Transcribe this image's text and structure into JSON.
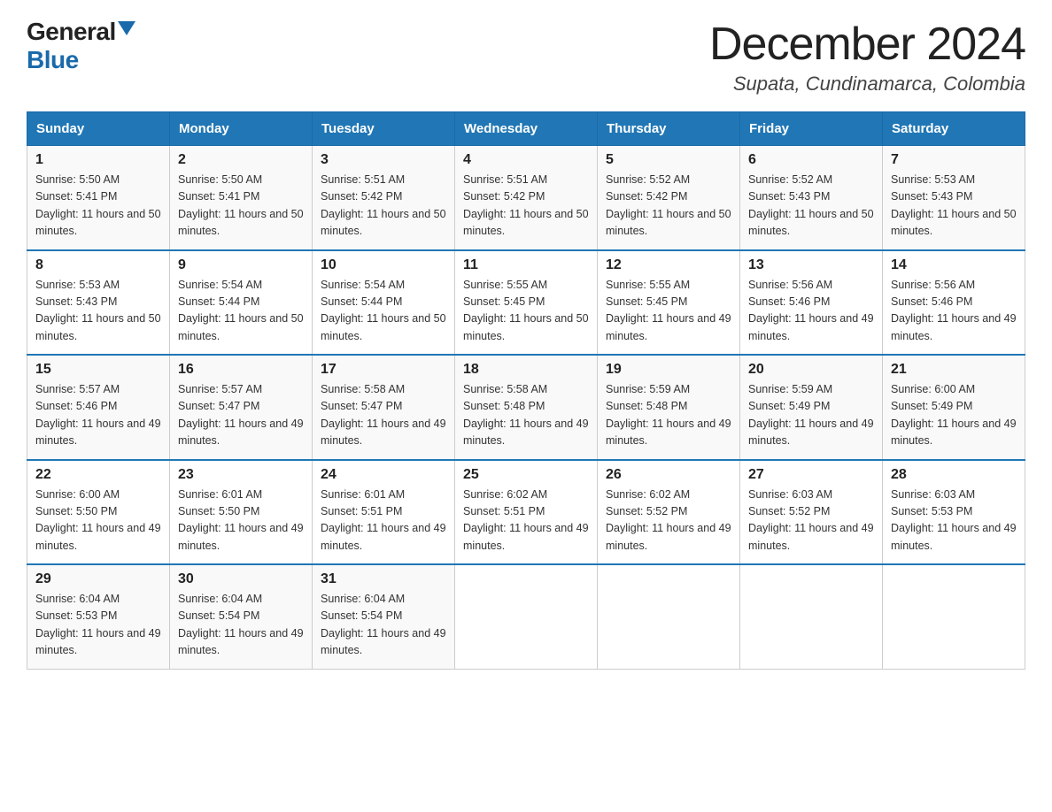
{
  "header": {
    "logo_general": "General",
    "logo_blue": "Blue",
    "month_title": "December 2024",
    "location": "Supata, Cundinamarca, Colombia"
  },
  "weekdays": [
    "Sunday",
    "Monday",
    "Tuesday",
    "Wednesday",
    "Thursday",
    "Friday",
    "Saturday"
  ],
  "weeks": [
    [
      {
        "day": 1,
        "sunrise": "5:50 AM",
        "sunset": "5:41 PM",
        "daylight": "11 hours and 50 minutes."
      },
      {
        "day": 2,
        "sunrise": "5:50 AM",
        "sunset": "5:41 PM",
        "daylight": "11 hours and 50 minutes."
      },
      {
        "day": 3,
        "sunrise": "5:51 AM",
        "sunset": "5:42 PM",
        "daylight": "11 hours and 50 minutes."
      },
      {
        "day": 4,
        "sunrise": "5:51 AM",
        "sunset": "5:42 PM",
        "daylight": "11 hours and 50 minutes."
      },
      {
        "day": 5,
        "sunrise": "5:52 AM",
        "sunset": "5:42 PM",
        "daylight": "11 hours and 50 minutes."
      },
      {
        "day": 6,
        "sunrise": "5:52 AM",
        "sunset": "5:43 PM",
        "daylight": "11 hours and 50 minutes."
      },
      {
        "day": 7,
        "sunrise": "5:53 AM",
        "sunset": "5:43 PM",
        "daylight": "11 hours and 50 minutes."
      }
    ],
    [
      {
        "day": 8,
        "sunrise": "5:53 AM",
        "sunset": "5:43 PM",
        "daylight": "11 hours and 50 minutes."
      },
      {
        "day": 9,
        "sunrise": "5:54 AM",
        "sunset": "5:44 PM",
        "daylight": "11 hours and 50 minutes."
      },
      {
        "day": 10,
        "sunrise": "5:54 AM",
        "sunset": "5:44 PM",
        "daylight": "11 hours and 50 minutes."
      },
      {
        "day": 11,
        "sunrise": "5:55 AM",
        "sunset": "5:45 PM",
        "daylight": "11 hours and 50 minutes."
      },
      {
        "day": 12,
        "sunrise": "5:55 AM",
        "sunset": "5:45 PM",
        "daylight": "11 hours and 49 minutes."
      },
      {
        "day": 13,
        "sunrise": "5:56 AM",
        "sunset": "5:46 PM",
        "daylight": "11 hours and 49 minutes."
      },
      {
        "day": 14,
        "sunrise": "5:56 AM",
        "sunset": "5:46 PM",
        "daylight": "11 hours and 49 minutes."
      }
    ],
    [
      {
        "day": 15,
        "sunrise": "5:57 AM",
        "sunset": "5:46 PM",
        "daylight": "11 hours and 49 minutes."
      },
      {
        "day": 16,
        "sunrise": "5:57 AM",
        "sunset": "5:47 PM",
        "daylight": "11 hours and 49 minutes."
      },
      {
        "day": 17,
        "sunrise": "5:58 AM",
        "sunset": "5:47 PM",
        "daylight": "11 hours and 49 minutes."
      },
      {
        "day": 18,
        "sunrise": "5:58 AM",
        "sunset": "5:48 PM",
        "daylight": "11 hours and 49 minutes."
      },
      {
        "day": 19,
        "sunrise": "5:59 AM",
        "sunset": "5:48 PM",
        "daylight": "11 hours and 49 minutes."
      },
      {
        "day": 20,
        "sunrise": "5:59 AM",
        "sunset": "5:49 PM",
        "daylight": "11 hours and 49 minutes."
      },
      {
        "day": 21,
        "sunrise": "6:00 AM",
        "sunset": "5:49 PM",
        "daylight": "11 hours and 49 minutes."
      }
    ],
    [
      {
        "day": 22,
        "sunrise": "6:00 AM",
        "sunset": "5:50 PM",
        "daylight": "11 hours and 49 minutes."
      },
      {
        "day": 23,
        "sunrise": "6:01 AM",
        "sunset": "5:50 PM",
        "daylight": "11 hours and 49 minutes."
      },
      {
        "day": 24,
        "sunrise": "6:01 AM",
        "sunset": "5:51 PM",
        "daylight": "11 hours and 49 minutes."
      },
      {
        "day": 25,
        "sunrise": "6:02 AM",
        "sunset": "5:51 PM",
        "daylight": "11 hours and 49 minutes."
      },
      {
        "day": 26,
        "sunrise": "6:02 AM",
        "sunset": "5:52 PM",
        "daylight": "11 hours and 49 minutes."
      },
      {
        "day": 27,
        "sunrise": "6:03 AM",
        "sunset": "5:52 PM",
        "daylight": "11 hours and 49 minutes."
      },
      {
        "day": 28,
        "sunrise": "6:03 AM",
        "sunset": "5:53 PM",
        "daylight": "11 hours and 49 minutes."
      }
    ],
    [
      {
        "day": 29,
        "sunrise": "6:04 AM",
        "sunset": "5:53 PM",
        "daylight": "11 hours and 49 minutes."
      },
      {
        "day": 30,
        "sunrise": "6:04 AM",
        "sunset": "5:54 PM",
        "daylight": "11 hours and 49 minutes."
      },
      {
        "day": 31,
        "sunrise": "6:04 AM",
        "sunset": "5:54 PM",
        "daylight": "11 hours and 49 minutes."
      },
      null,
      null,
      null,
      null
    ]
  ]
}
